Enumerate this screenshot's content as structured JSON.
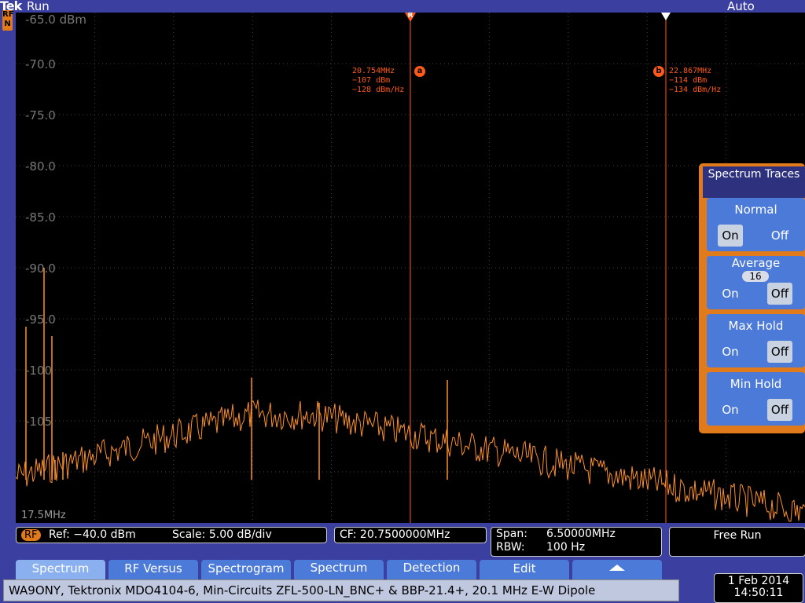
{
  "header": {
    "logo": "Tek",
    "run_state": "Run",
    "trigger_mode": "Auto",
    "channel_badge": "RF\nN"
  },
  "plot": {
    "y_labels": [
      "-65.0 dBm",
      "-70.0",
      "-75.0",
      "-80.0",
      "-85.0",
      "-90.0",
      "-95.0",
      "-100",
      "-105"
    ],
    "start_freq": "17.5MHz",
    "ref_marker": "R",
    "marker_a": {
      "id": "a",
      "freq": "20.754MHz",
      "power": "−107 dBm",
      "density": "−128 dBm/Hz"
    },
    "marker_b": {
      "id": "b",
      "freq": "22.867MHz",
      "power": "−114 dBm",
      "density": "−134 dBm/Hz"
    },
    "trace_color": "#ff9020",
    "marker_color": "#ff5a1a"
  },
  "status": {
    "rf_tag": "RF",
    "ref": "Ref: −40.0 dBm",
    "scale": "Scale: 5.00 dB/div",
    "cf": "CF:  20.7500000MHz",
    "span_label": "Span:",
    "span_value": "6.50000MHz",
    "rbw_label": "RBW:",
    "rbw_value": "100 Hz",
    "mode": "Free Run"
  },
  "side_menu": {
    "title": "Spectrum Traces",
    "normal": {
      "label": "Normal",
      "on": "On",
      "off": "Off"
    },
    "average": {
      "label": "Average",
      "count": "16",
      "on": "On",
      "off": "Off"
    },
    "max_hold": {
      "label": "Max Hold",
      "on": "On",
      "off": "Off"
    },
    "min_hold": {
      "label": "Min Hold",
      "on": "On",
      "off": "Off"
    }
  },
  "tabs": [
    {
      "label": "Spectrum"
    },
    {
      "label": "RF Versus"
    },
    {
      "label": "Spectrogram"
    },
    {
      "label": "Spectrum"
    },
    {
      "label": "Detection"
    },
    {
      "label": "Edit"
    }
  ],
  "caption": "WA9ONY, Tektronix MDO4104-6, Min-Circuits ZFL-500-LN_BNC+ & BBP-21.4+, 20.1 MHz E-W Dipole",
  "datetime": {
    "date": "1 Feb  2014",
    "time": "14:50:11"
  }
}
